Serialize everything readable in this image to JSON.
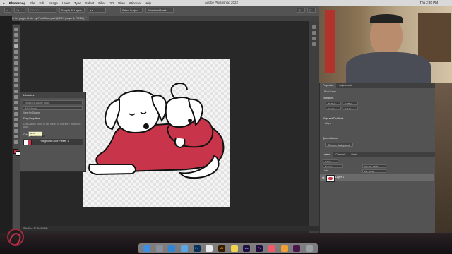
{
  "menubar": {
    "app": "Photoshop",
    "items": [
      "File",
      "Edit",
      "Image",
      "Layer",
      "Type",
      "Select",
      "Filter",
      "3D",
      "View",
      "Window",
      "Help"
    ],
    "title": "Adobe Photoshop 2022",
    "clock": "Thu 2:20 PM"
  },
  "options_bar": {
    "sample_label": "Sample All Layers",
    "select_subject": "Select Subject",
    "select_and_mask": "Select and Mask..."
  },
  "document_tab": "Dog with her puppy Under by PhotoCoop.psd @ 25% (Layer 1, RGB/8) *",
  "libraries": {
    "title": "Libraries",
    "search_placeholder": "Search in Adobe Stock",
    "library_name": "My Library",
    "view_label": "View by Groups",
    "section_heading": "Drag Drop Here",
    "hint": "Drag Adobe Stock in this library or use the + button to add...",
    "colors_label": "Colors",
    "item_label": "Foreground Color Preset: 1"
  },
  "tooltip": {
    "line1": "Set to",
    "line2": "foreground color"
  },
  "properties": {
    "tabs": [
      "Properties",
      "Adjustments"
    ],
    "layer_type": "Pixel Layer",
    "transform_label": "Transform",
    "w_value": "W: 00 px",
    "h_value": "H: 00 px",
    "x_value": "X: 0 px",
    "y_value": "Y: 0 px",
    "align_label": "Align and Distribute",
    "align_sub": "Align:",
    "quick_actions": "Quick Actions",
    "remove_background": "Remove Background"
  },
  "layers": {
    "tabs": [
      "Layers",
      "Channels",
      "Paths"
    ],
    "filter": "Q Kind",
    "blend_mode": "Normal",
    "opacity": "Opacity: 100%",
    "lock_label": "Lock:",
    "fill": "Fill: 100%",
    "layer_name": "Layer 1"
  },
  "status": "25%     Doc: 50.6M/50.6M",
  "dock_apps": [
    "Finder",
    "Launchpad",
    "Safari",
    "Mail",
    "Ps",
    "Chrome",
    "Ai",
    "Notes",
    "Ae",
    "Pr",
    "Music",
    "Photos",
    "Slack",
    "Trash"
  ]
}
